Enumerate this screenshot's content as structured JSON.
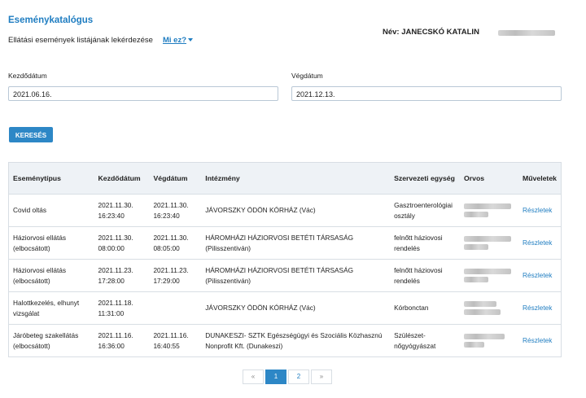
{
  "header": {
    "title": "Eseménykatalógus",
    "subtitle": "Ellátási események listájának lekérdezése",
    "whatis": "Mi ez?",
    "name_label": "Név: JANECSKÓ KATALIN"
  },
  "filters": {
    "start_label": "Kezdődátum",
    "start_value": "2021.06.16.",
    "end_label": "Végdátum",
    "end_value": "2021.12.13.",
    "search_label": "KERESÉS"
  },
  "table": {
    "headers": [
      "Eseménytípus",
      "Kezdődátum",
      "Végdátum",
      "Intézmény",
      "Szervezeti egység",
      "Orvos",
      "Műveletek"
    ],
    "rows": [
      {
        "type": "Covid oltás",
        "start": "2021.11.30. 16:23:40",
        "end": "2021.11.30. 16:23:40",
        "inst": "JÁVORSZKY ÖDÖN KÓRHÁZ (Vác)",
        "unit": "Gasztroenterológiai osztály",
        "action": "Részletek"
      },
      {
        "type": "Háziorvosi ellátás (elbocsátott)",
        "start": "2021.11.30. 08:00:00",
        "end": "2021.11.30. 08:05:00",
        "inst": "HÁROMHÁZI HÁZIORVOSI BETÉTI TÁRSASÁG (Pilisszentiván)",
        "unit": "felnőtt háziovosi rendelés",
        "action": "Részletek"
      },
      {
        "type": "Háziorvosi ellátás (elbocsátott)",
        "start": "2021.11.23. 17:28:00",
        "end": "2021.11.23. 17:29:00",
        "inst": "HÁROMHÁZI HÁZIORVOSI BETÉTI TÁRSASÁG (Pilisszentiván)",
        "unit": "felnőtt háziovosi rendelés",
        "action": "Részletek"
      },
      {
        "type": "Halottkezelés, elhunyt vizsgálat",
        "start": "2021.11.18. 11:31:00",
        "end": "",
        "inst": "JÁVORSZKY ÖDÖN KÓRHÁZ (Vác)",
        "unit": "Kórbonctan",
        "action": "Részletek"
      },
      {
        "type": "Járóbeteg szakellátás (elbocsátott)",
        "start": "2021.11.16. 16:36:00",
        "end": "2021.11.16. 16:40:55",
        "inst": "DUNAKESZI- SZTK Egészségügyi és Szociális Közhasznú Nonprofit Kft. (Dunakeszi)",
        "unit": "Szülészet-nőgyógyászat",
        "action": "Részletek"
      }
    ]
  },
  "pagination": {
    "prev": "«",
    "pages": [
      "1",
      "2"
    ],
    "active": "1",
    "next": "»"
  }
}
